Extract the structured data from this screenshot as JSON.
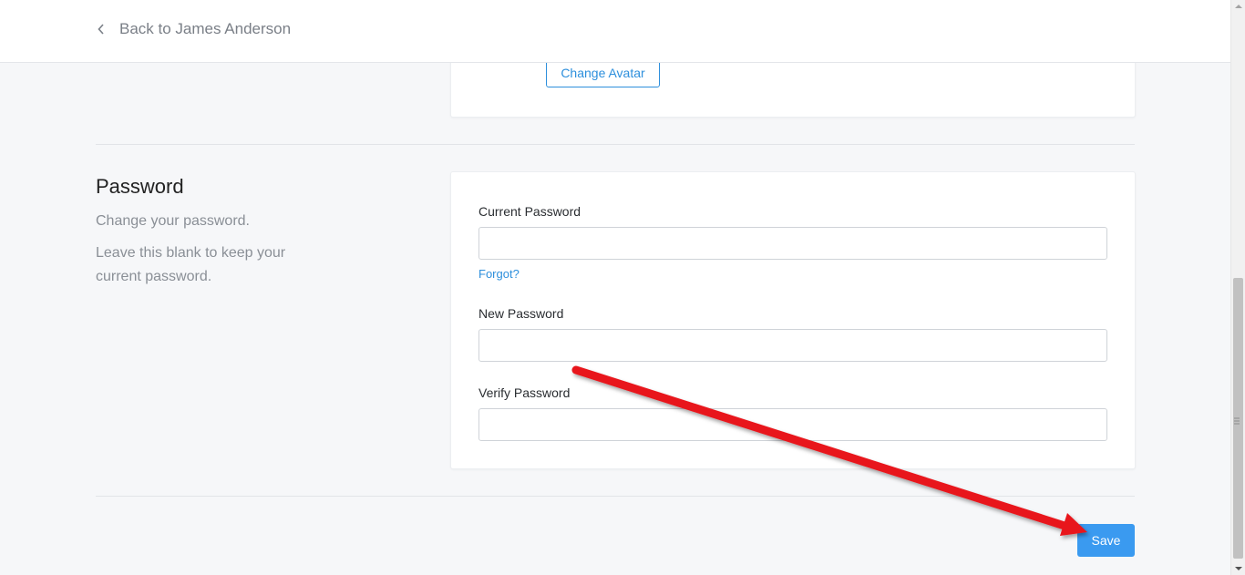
{
  "topbar": {
    "back_label": "Back to James Anderson"
  },
  "avatar_section": {
    "change_avatar_label": "Change Avatar"
  },
  "password_section": {
    "title": "Password",
    "description": "Change your password.",
    "hint": "Leave this blank to keep your current password.",
    "fields": {
      "current_password": {
        "label": "Current Password",
        "value": "",
        "placeholder": ""
      },
      "new_password": {
        "label": "New Password",
        "value": "",
        "placeholder": ""
      },
      "verify_password": {
        "label": "Verify Password",
        "value": "",
        "placeholder": ""
      }
    },
    "forgot_label": "Forgot?"
  },
  "actions": {
    "save_label": "Save"
  },
  "colors": {
    "accent": "#3a9af0",
    "link": "#2d8fdc",
    "annotation_arrow": "#e8151b",
    "background": "#f6f7f9"
  },
  "icons": {
    "back": "chevron-left-icon",
    "annotation": "red-arrow-annotation"
  }
}
